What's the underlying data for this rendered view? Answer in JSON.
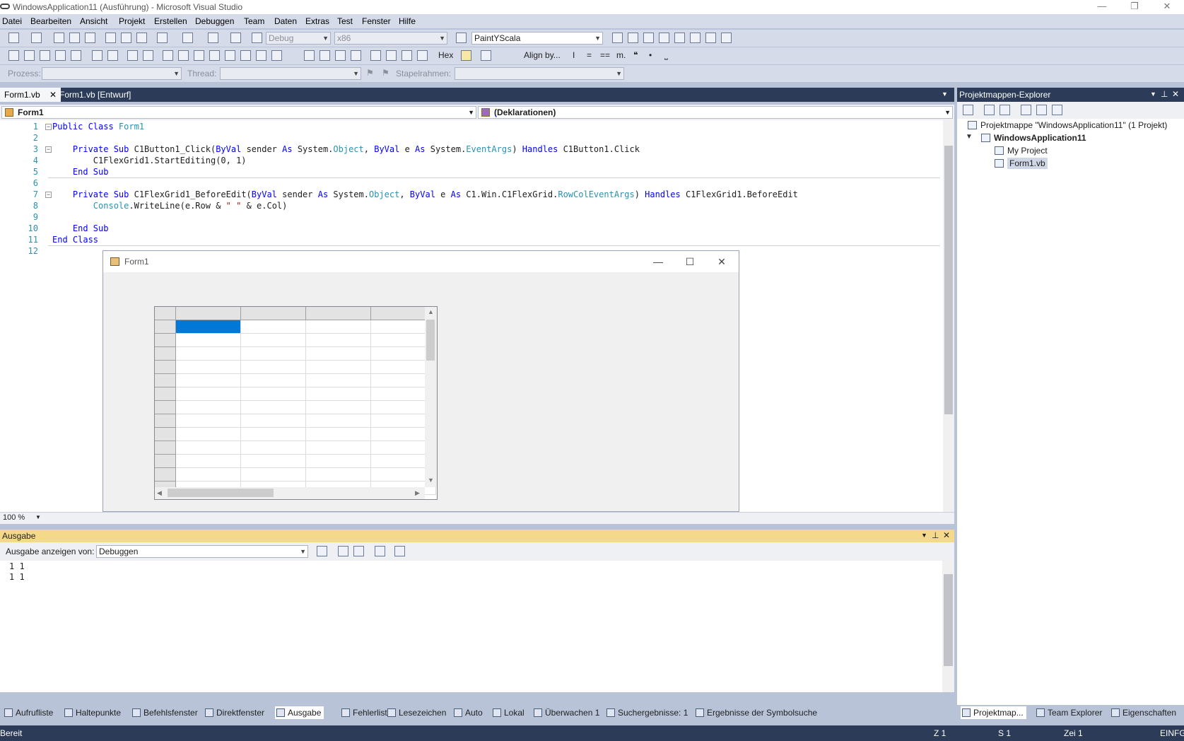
{
  "window": {
    "title": "WindowsApplication11 (Ausführung) - Microsoft Visual Studio"
  },
  "menu": [
    "Datei",
    "Bearbeiten",
    "Ansicht",
    "Projekt",
    "Erstellen",
    "Debuggen",
    "Team",
    "Daten",
    "Extras",
    "Test",
    "Fenster",
    "Hilfe"
  ],
  "toolbar1": {
    "config": "Debug",
    "platform": "x86",
    "find": "PaintYScala"
  },
  "toolbar2": {
    "hex": "Hex",
    "align": "Align by..."
  },
  "toolbar3": {
    "process_label": "Prozess:",
    "thread_label": "Thread:",
    "stack_label": "Stapelrahmen:"
  },
  "doc_tabs": [
    "Form1.vb",
    "Form1.vb [Entwurf]"
  ],
  "nav": {
    "left": "Form1",
    "right": "(Deklarationen)"
  },
  "code": [
    {
      "n": "1",
      "tokens": [
        [
          "kw",
          "Public Class "
        ],
        [
          "ty",
          "Form1"
        ]
      ]
    },
    {
      "n": "2",
      "tokens": []
    },
    {
      "n": "3",
      "tokens": [
        [
          "",
          "    "
        ],
        [
          "kw",
          "Private Sub "
        ],
        [
          "",
          "C1Button1_Click("
        ],
        [
          "kw",
          "ByVal "
        ],
        [
          "",
          "sender "
        ],
        [
          "kw",
          "As "
        ],
        [
          "",
          "System."
        ],
        [
          "ty",
          "Object"
        ],
        [
          "",
          ", "
        ],
        [
          "kw",
          "ByVal "
        ],
        [
          "",
          "e "
        ],
        [
          "kw",
          "As "
        ],
        [
          "",
          "System."
        ],
        [
          "ty",
          "EventArgs"
        ],
        [
          "",
          ") "
        ],
        [
          "kw",
          "Handles "
        ],
        [
          "",
          "C1Button1.Click"
        ]
      ]
    },
    {
      "n": "4",
      "tokens": [
        [
          "",
          "        C1FlexGrid1.StartEditing(0, 1)"
        ]
      ]
    },
    {
      "n": "5",
      "tokens": [
        [
          "",
          "    "
        ],
        [
          "kw",
          "End Sub"
        ]
      ]
    },
    {
      "n": "6",
      "tokens": []
    },
    {
      "n": "7",
      "tokens": [
        [
          "",
          "    "
        ],
        [
          "kw",
          "Private Sub "
        ],
        [
          "",
          "C1FlexGrid1_BeforeEdit("
        ],
        [
          "kw",
          "ByVal "
        ],
        [
          "",
          "sender "
        ],
        [
          "kw",
          "As "
        ],
        [
          "",
          "System."
        ],
        [
          "ty",
          "Object"
        ],
        [
          "",
          ", "
        ],
        [
          "kw",
          "ByVal "
        ],
        [
          "",
          "e "
        ],
        [
          "kw",
          "As "
        ],
        [
          "",
          "C1.Win.C1FlexGrid."
        ],
        [
          "ty",
          "RowColEventArgs"
        ],
        [
          "",
          ") "
        ],
        [
          "kw",
          "Handles "
        ],
        [
          "",
          "C1FlexGrid1.BeforeEdit"
        ]
      ]
    },
    {
      "n": "8",
      "tokens": [
        [
          "",
          "        "
        ],
        [
          "ty",
          "Console"
        ],
        [
          "",
          ".WriteLine(e.Row & "
        ],
        [
          "st",
          "\" \""
        ],
        [
          "",
          ""
        ],
        [
          "",
          ""
        ],
        [
          "",
          " & e.Col)"
        ]
      ]
    },
    {
      "n": "9",
      "tokens": []
    },
    {
      "n": "10",
      "tokens": [
        [
          "",
          "    "
        ],
        [
          "kw",
          "End Sub"
        ]
      ]
    },
    {
      "n": "11",
      "tokens": [
        [
          "kw",
          "End Class"
        ]
      ]
    },
    {
      "n": "12",
      "tokens": []
    }
  ],
  "zoom": "100 %",
  "form": {
    "title": "Form1"
  },
  "output": {
    "title": "Ausgabe",
    "show_label": "Ausgabe anzeigen von:",
    "source": "Debuggen",
    "lines": [
      "1 1",
      "1 1"
    ]
  },
  "solution": {
    "title": "Projektmappen-Explorer",
    "root": "Projektmappe \"WindowsApplication11\" (1 Projekt)",
    "project": "WindowsApplication11",
    "items": [
      "My Project",
      "Form1.vb"
    ]
  },
  "bottom_tabs": [
    "Aufrufliste",
    "Haltepunkte",
    "Befehlsfenster",
    "Direktfenster",
    "Ausgabe",
    "Fehlerliste",
    "Lesezeichen",
    "Auto",
    "Lokal",
    "Überwachen 1",
    "Suchergebnisse: 1",
    "Ergebnisse der Symbolsuche"
  ],
  "right_tabs": [
    "Projektmap...",
    "Team Explorer",
    "Eigenschaften"
  ],
  "status": {
    "left": "Bereit",
    "line": "Z 1",
    "col": "S 1",
    "char": "Zei 1",
    "mode": "EINFG"
  }
}
